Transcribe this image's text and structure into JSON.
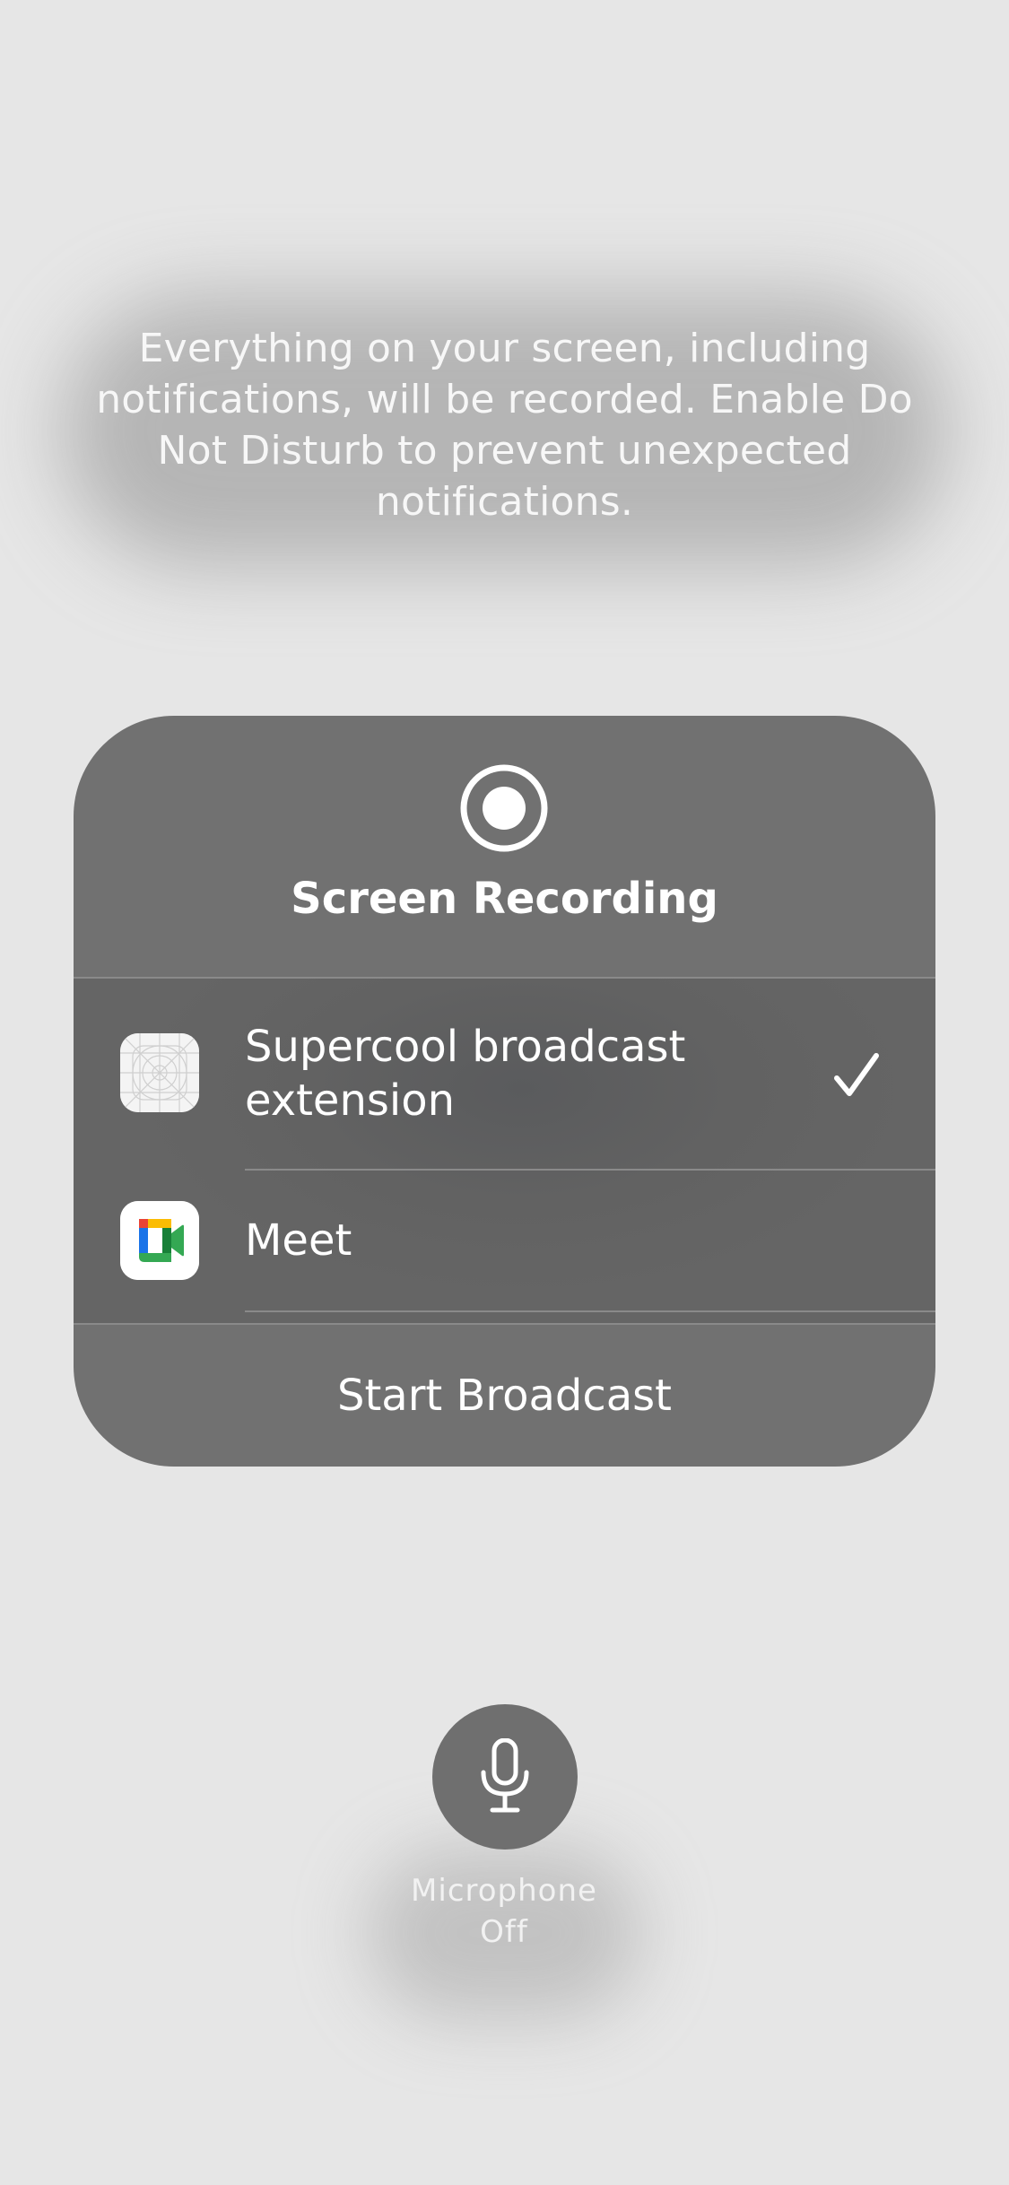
{
  "notice": {
    "text": "Everything on your screen, including notifications, will be recorded. Enable Do Not Disturb to prevent unexpected notifications."
  },
  "panel": {
    "icon": "record-icon",
    "title": "Screen Recording",
    "options": [
      {
        "label": "Supercool broadcast extension",
        "icon": "app-placeholder-icon",
        "selected": true
      },
      {
        "label": "Meet",
        "icon": "google-meet-icon",
        "selected": false
      }
    ],
    "start_label": "Start Broadcast"
  },
  "microphone": {
    "icon": "microphone-icon",
    "label": "Microphone",
    "status": "Off"
  },
  "colors": {
    "background": "#e6e6e6",
    "panel": "#717171",
    "panel_list": "#626262",
    "meet_blue": "#1a73e8",
    "meet_red": "#ea4335",
    "meet_yellow": "#fbbc04",
    "meet_green": "#34a853",
    "meet_dark_green": "#188038"
  }
}
